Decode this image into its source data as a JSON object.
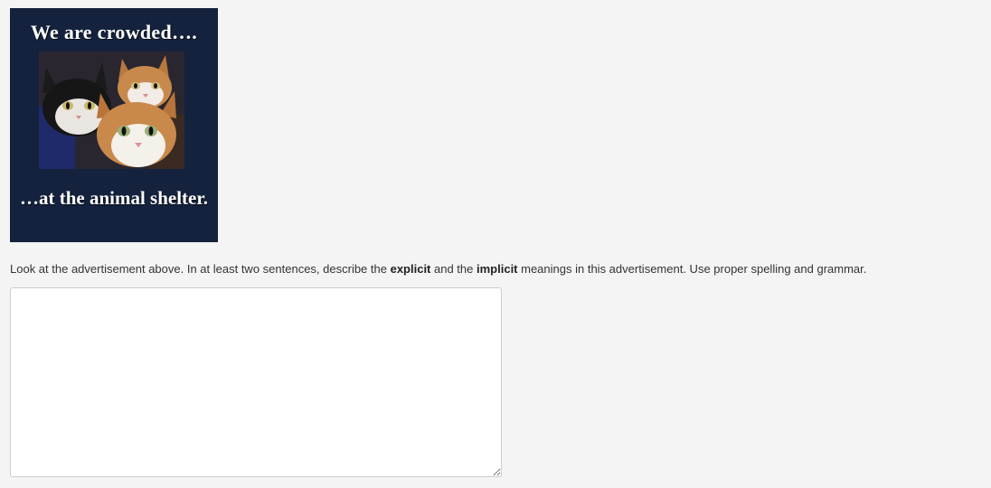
{
  "advertisement": {
    "top_text": "We are crowded….",
    "bottom_text": "…at the animal shelter.",
    "background_color": "#14223d",
    "photo_subject": "three kittens"
  },
  "question": {
    "prompt_part1": "Look at the advertisement above. In at least two sentences, describe the ",
    "explicit_word": "explicit",
    "prompt_part2": " and the ",
    "implicit_word": "implicit",
    "prompt_part3": " meanings in this advertisement. Use proper spelling and grammar."
  },
  "answer_box": {
    "value": "",
    "placeholder": ""
  }
}
